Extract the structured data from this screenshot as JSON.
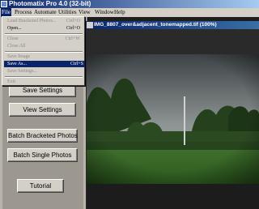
{
  "window": {
    "title": "Photomatix Pro 4.0 (32-bit)"
  },
  "menubar": [
    "File",
    "Process",
    "Automate",
    "Utilities",
    "View",
    "Window",
    "Help"
  ],
  "file_menu": {
    "items": [
      {
        "label": "Load Bracketed Photos...",
        "shortcut": "Ctrl+O",
        "state": "disabled"
      },
      {
        "label": "Open...",
        "shortcut": "Ctrl+O",
        "state": "normal"
      },
      {
        "label": "Close",
        "shortcut": "Ctrl+W",
        "state": "disabled"
      },
      {
        "label": "Close All",
        "shortcut": "",
        "state": "disabled"
      },
      {
        "label": "Save Image",
        "shortcut": "",
        "state": "disabled"
      },
      {
        "label": "Save As...",
        "shortcut": "Ctrl+S",
        "state": "selected"
      },
      {
        "label": "Save Settings...",
        "shortcut": "",
        "state": "disabled"
      },
      {
        "label": "Exit",
        "shortcut": "",
        "state": "disabled"
      }
    ]
  },
  "workflow_buttons": [
    {
      "label": "Save Settings"
    },
    {
      "label": "View Settings"
    },
    {
      "label": "Batch Bracketed Photos"
    },
    {
      "label": "Batch Single Photos"
    },
    {
      "label": "Tutorial"
    }
  ],
  "image_window": {
    "title": "IMG_8807_over&adjacent_tonemapped.tif (100%)"
  }
}
